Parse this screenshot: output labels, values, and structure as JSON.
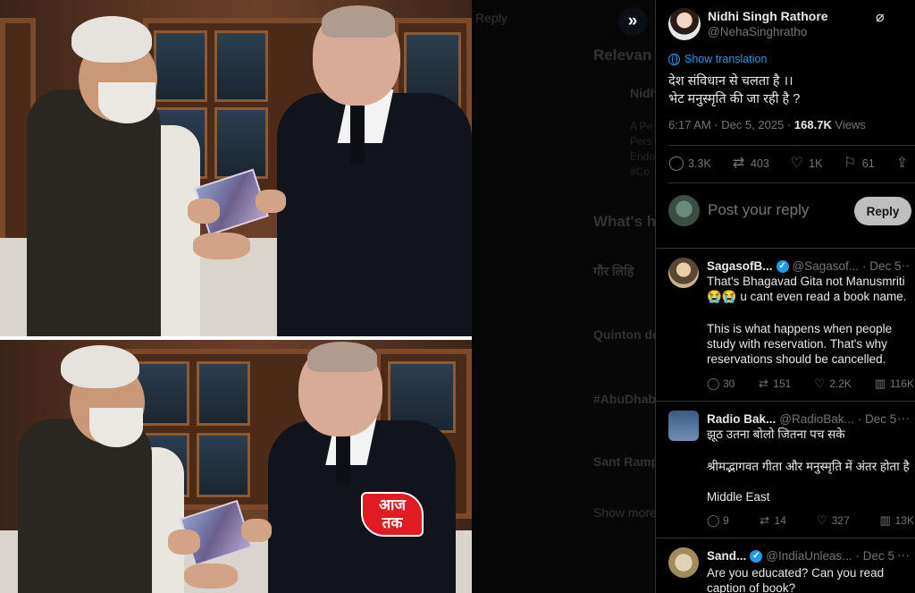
{
  "media": {
    "expand_icon": "double-chevron-right-icon",
    "watermark": {
      "line1": "आज",
      "line2": "तक"
    },
    "background_text": [
      "Reply",
      "Relevan",
      "Nidh",
      "A Pe",
      "Pers",
      "Endo",
      "#Co",
      "What's h",
      "गौर लिहि",
      "Quinton de",
      "#AbuDhab",
      "Sant Ramp",
      "Show more"
    ]
  },
  "tweet": {
    "author_name": "Nidhi Singh Rathore",
    "author_handle": "@NehaSinghratho",
    "show_translation": "Show translation",
    "text_line1": "देश संविधान से चलता है ।।",
    "text_line2": "भेट मनुस्मृति की जा रही है ?",
    "time": "6:17 AM · Dec 5, 2025 · ",
    "views_count": "168.7K",
    "views_label": " Views",
    "stats": {
      "replies": "3.3K",
      "reposts": "403",
      "likes": "1K",
      "bookmarks": "61"
    },
    "icons": {
      "reply": "reply-icon",
      "repost": "repost-icon",
      "like": "heart-icon",
      "bookmark": "bookmark-icon",
      "share": "share-icon",
      "grok": "grok-icon"
    }
  },
  "composer": {
    "placeholder": "Post your reply",
    "button": "Reply"
  },
  "replies": [
    {
      "name": "SagasofB...",
      "handle": "@Sagasof...",
      "date": "· Dec 5",
      "verified": true,
      "lines": [
        "That's Bhagavad Gita not Manusmriti",
        "😭😭 u cant even read a book name.",
        "",
        "This is what happens when people",
        "study with reservation. That's why",
        "reservations should be cancelled."
      ],
      "stats": {
        "replies": "30",
        "reposts": "151",
        "likes": "2.2K",
        "views": "116K"
      }
    },
    {
      "name": "Radio Bak...",
      "handle": "@RadioBak...",
      "date": "· Dec 5",
      "verified": false,
      "lines": [
        "झूठ उतना बोलो जितना पच सके",
        "",
        "श्रीमद्भागवत गीता और मनुस्मृति में अंतर होता है",
        "",
        "Middle East"
      ],
      "stats": {
        "replies": "9",
        "reposts": "14",
        "likes": "327",
        "views": "13K"
      }
    },
    {
      "name": "Sand...",
      "handle": "@IndiaUnleas...",
      "date": "· Dec 5",
      "verified": true,
      "lines": [
        "Are you educated? Can you read",
        "caption of book?"
      ]
    }
  ],
  "more_icon": "···"
}
